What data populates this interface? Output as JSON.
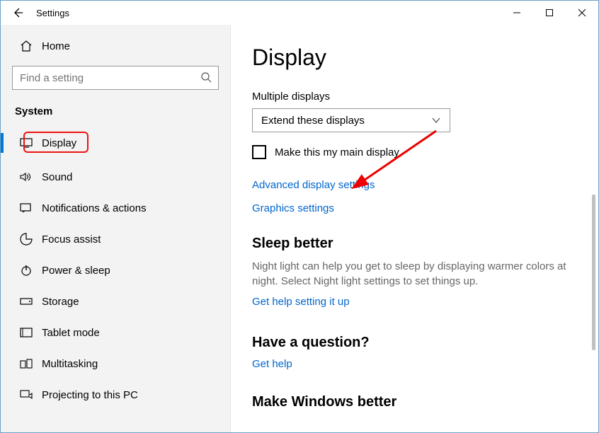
{
  "titlebar": {
    "title": "Settings"
  },
  "sidebar": {
    "home": "Home",
    "search_placeholder": "Find a setting",
    "section": "System",
    "items": [
      {
        "label": "Display"
      },
      {
        "label": "Sound"
      },
      {
        "label": "Notifications & actions"
      },
      {
        "label": "Focus assist"
      },
      {
        "label": "Power & sleep"
      },
      {
        "label": "Storage"
      },
      {
        "label": "Tablet mode"
      },
      {
        "label": "Multitasking"
      },
      {
        "label": "Projecting to this PC"
      }
    ]
  },
  "main": {
    "heading": "Display",
    "multidisplay_label": "Multiple displays",
    "multidisplay_value": "Extend these displays",
    "main_display_checkbox": "Make this my main display",
    "link_advanced": "Advanced display settings",
    "link_graphics": "Graphics settings",
    "sleep_head": "Sleep better",
    "sleep_desc": "Night light can help you get to sleep by displaying warmer colors at night. Select Night light settings to set things up.",
    "link_sleep": "Get help setting it up",
    "question_head": "Have a question?",
    "link_question": "Get help",
    "windows_head": "Make Windows better"
  }
}
